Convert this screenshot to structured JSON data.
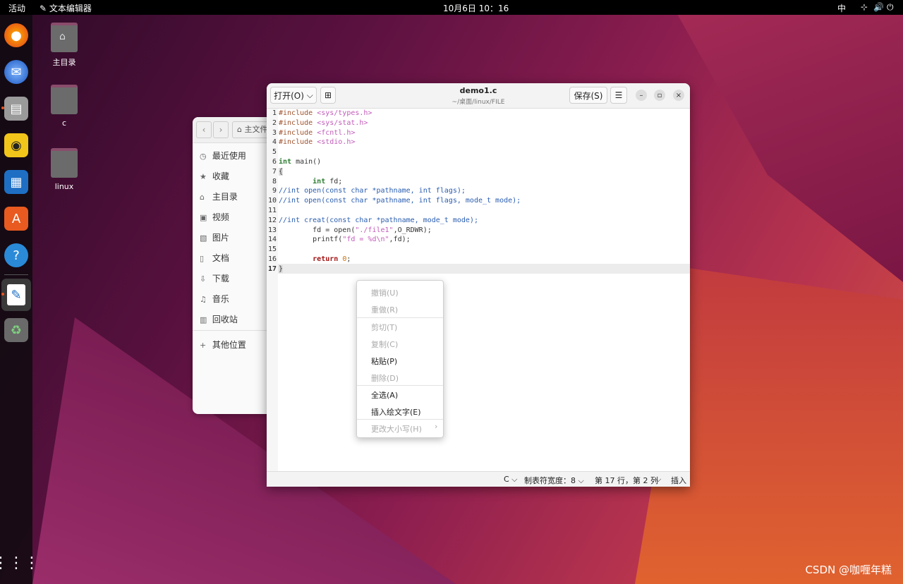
{
  "topbar": {
    "activities": "活动",
    "app_name": "文本编辑器",
    "clock": "10月6日  10：16",
    "input_method": "中",
    "icons": [
      "network-icon",
      "volume-icon",
      "power-icon"
    ]
  },
  "dock": {
    "items": [
      "firefox-icon",
      "thunderbird-icon",
      "files-icon",
      "rhythmbox-icon",
      "libreoffice-writer-icon",
      "app-center-icon",
      "help-icon",
      "text-editor-icon",
      "trash-icon"
    ],
    "show_apps": "show-apps-icon"
  },
  "desktop": {
    "icons": [
      {
        "label": "主目录"
      },
      {
        "label": "c"
      },
      {
        "label": "linux"
      }
    ]
  },
  "file_manager": {
    "path_label": "主文件",
    "sidebar": [
      {
        "label": "最近使用",
        "icon": "clock-icon"
      },
      {
        "label": "收藏",
        "icon": "star-icon"
      },
      {
        "label": "主目录",
        "icon": "home-icon"
      },
      {
        "label": "视频",
        "icon": "video-icon"
      },
      {
        "label": "图片",
        "icon": "image-icon"
      },
      {
        "label": "文档",
        "icon": "document-icon"
      },
      {
        "label": "下载",
        "icon": "download-icon"
      },
      {
        "label": "音乐",
        "icon": "music-icon"
      },
      {
        "label": "回收站",
        "icon": "trash-icon"
      },
      {
        "label": "其他位置",
        "icon": "plus-icon"
      }
    ]
  },
  "editor": {
    "open_label": "打开(O)",
    "title": "demo1.c",
    "subtitle": "~/桌面/linux/FILE",
    "save_label": "保存(S)",
    "menu_icon": "hamburger-icon",
    "lines": [
      "1",
      "2",
      "3",
      "4",
      "5",
      "6",
      "7",
      "8",
      "9",
      "10",
      "11",
      "12",
      "13",
      "14",
      "15",
      "16",
      "17"
    ],
    "code": {
      "l1a": "#include ",
      "l1b": "<sys/types.h>",
      "l2a": "#include ",
      "l2b": "<sys/stat.h>",
      "l3a": "#include ",
      "l3b": "<fcntl.h>",
      "l4a": "#include ",
      "l4b": "<stdio.h>",
      "l6a": "int",
      "l6b": " main()",
      "l7": "{",
      "l8a": "        int",
      "l8b": " fd;",
      "l9": "//int open(const char *pathname, int flags);",
      "l10": "//int open(const char *pathname, int flags, mode_t mode);",
      "l12": "//int creat(const char *pathname, mode_t mode);",
      "l13a": "        fd = open(",
      "l13b": "\"./file1\"",
      "l13c": ",O_RDWR);",
      "l14a": "        printf(",
      "l14b": "\"fd = %d\\n\"",
      "l14c": ",fd);",
      "l16a": "        return",
      "l16b": " ",
      "l16c": "0",
      "l16d": ";",
      "l17": "}"
    },
    "status": {
      "language": "C ⌵",
      "tab_width": "制表符宽度：8 ⌵",
      "position": "第 17 行，第 2 列",
      "dropdown": "⌵",
      "mode": "插入"
    }
  },
  "context_menu": {
    "items": [
      {
        "label": "撤销(U)",
        "enabled": false
      },
      {
        "label": "重做(R)",
        "enabled": false
      },
      {
        "label": "剪切(T)",
        "enabled": false
      },
      {
        "label": "复制(C)",
        "enabled": false
      },
      {
        "label": "粘贴(P)",
        "enabled": true
      },
      {
        "label": "删除(D)",
        "enabled": false
      },
      {
        "label": "全选(A)",
        "enabled": true
      },
      {
        "label": "插入绘文字(E)",
        "enabled": true
      },
      {
        "label": "更改大小写(H)",
        "enabled": false
      }
    ],
    "submenu_arrow": "›"
  },
  "watermark": "CSDN @咖喱年糕"
}
